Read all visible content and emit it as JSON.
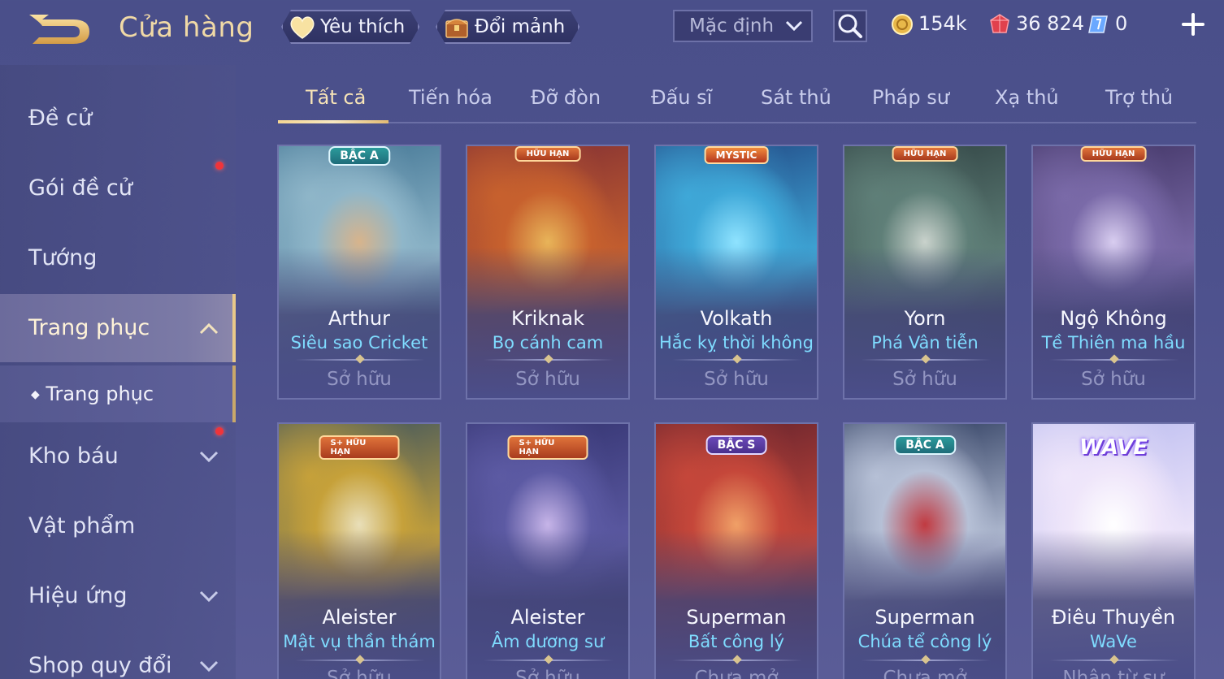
{
  "header": {
    "title": "Cửa hàng",
    "favorite_label": "Yêu thích",
    "exchange_label": "Đổi mảnh",
    "sort_value": "Mặc định"
  },
  "currencies": {
    "gold": "154k",
    "gems": "36 824",
    "vouchers": "0"
  },
  "sidebar": {
    "items": [
      {
        "label": "Đề cử"
      },
      {
        "label": "Gói đề cử"
      },
      {
        "label": "Tướng"
      },
      {
        "label": "Trang phục"
      },
      {
        "label": "Kho báu"
      },
      {
        "label": "Vật phẩm"
      },
      {
        "label": "Hiệu ứng"
      },
      {
        "label": "Shop quy đổi"
      }
    ],
    "sub_item": "Trang phục"
  },
  "tabs": [
    "Tất cả",
    "Tiến hóa",
    "Đỡ đòn",
    "Đấu sĩ",
    "Sát thủ",
    "Pháp sư",
    "Xạ thủ",
    "Trợ thủ"
  ],
  "cards": [
    {
      "hero": "Arthur",
      "skin": "Siêu sao Cricket",
      "status": "Sở hữu",
      "badge": "BẬC A",
      "colors": [
        "#3b6f8f",
        "#8fb6c9",
        "#d7b48c"
      ]
    },
    {
      "hero": "Kriknak",
      "skin": "Bọ cánh cam",
      "status": "Sở hữu",
      "badge": "HỮU HẠN",
      "colors": [
        "#7a2a35",
        "#c7612e",
        "#e8b459"
      ]
    },
    {
      "hero": "Volkath",
      "skin": "Hắc kỵ thời không",
      "status": "Sở hữu",
      "badge": "MYSTIC",
      "colors": [
        "#1f3f7c",
        "#3fa8d8",
        "#8fe3ff"
      ]
    },
    {
      "hero": "Yorn",
      "skin": "Phá Vân tiễn",
      "status": "Sở hữu",
      "badge": "HỮU HẠN",
      "colors": [
        "#2c3d3e",
        "#5f7f78",
        "#c9d2cc"
      ]
    },
    {
      "hero": "Ngộ Không",
      "skin": "Tề Thiên ma hầu",
      "status": "Sở hữu",
      "badge": "HỮU HẠN",
      "colors": [
        "#3b2f5e",
        "#7a6aa8",
        "#d8cdf0"
      ]
    },
    {
      "hero": "Aleister",
      "skin": "Mật vụ thần thám",
      "status": "Sở hữu",
      "badge": "S+ HỮU HẠN",
      "colors": [
        "#2f4c62",
        "#c6a13a",
        "#e9dfb9"
      ]
    },
    {
      "hero": "Aleister",
      "skin": "Âm dương sư",
      "status": "Sở hữu",
      "badge": "S+ HỮU HẠN",
      "colors": [
        "#2f2f6a",
        "#5c5aa3",
        "#c6b4e8"
      ]
    },
    {
      "hero": "Superman",
      "skin": "Bất công lý",
      "status": "Chưa mở",
      "badge": "BẬC S",
      "colors": [
        "#5a1f2c",
        "#c5473a",
        "#f0a067"
      ]
    },
    {
      "hero": "Superman",
      "skin": "Chúa tể công lý",
      "status": "Chưa mở",
      "badge": "BẬC A",
      "colors": [
        "#1b2a4f",
        "#b6c0d6",
        "#c13a41"
      ]
    },
    {
      "hero": "Điêu Thuyền",
      "skin": "WaVe",
      "status": "Nhận từ sự",
      "badge": "WAVE",
      "colors": [
        "#b7b9ef",
        "#efe6fa",
        "#ffffff"
      ]
    }
  ]
}
